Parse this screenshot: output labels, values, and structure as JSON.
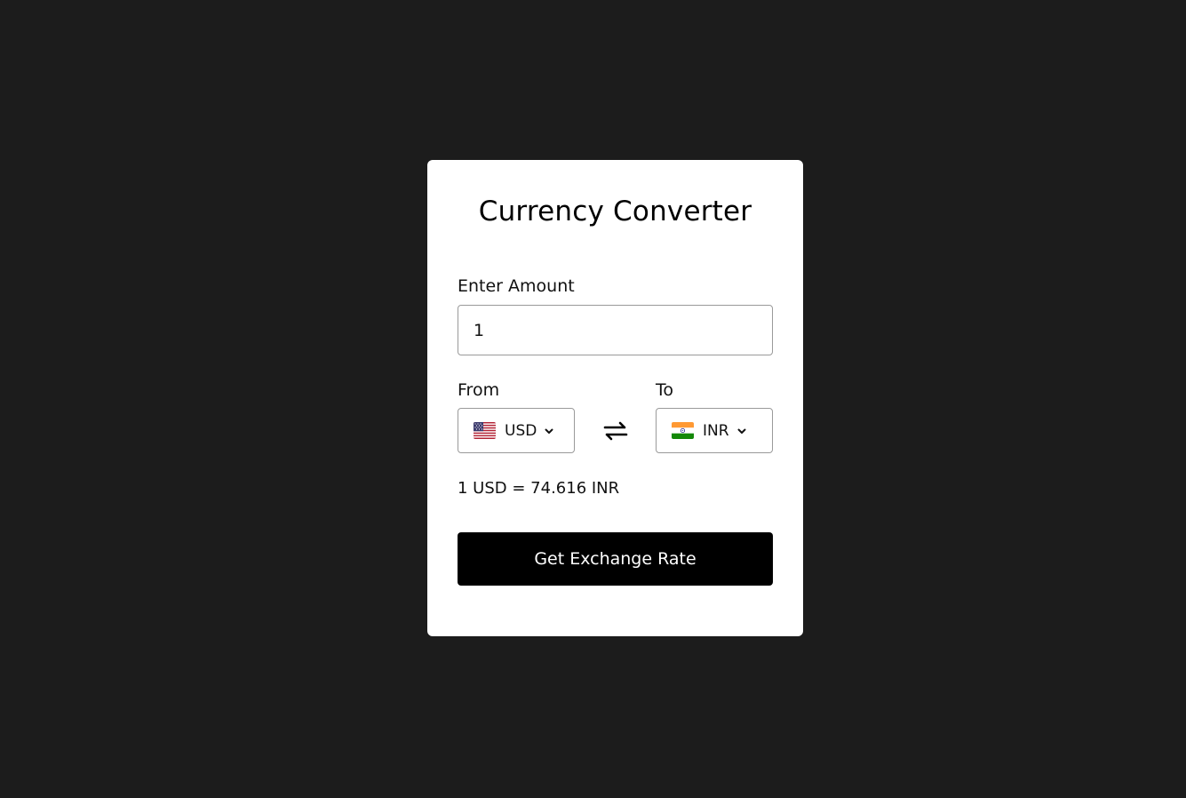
{
  "app": {
    "title": "Currency Converter"
  },
  "amount": {
    "label": "Enter Amount",
    "value": "1"
  },
  "from": {
    "label": "From",
    "currency": "USD",
    "flag_icon": "us-flag-icon"
  },
  "to": {
    "label": "To",
    "currency": "INR",
    "flag_icon": "india-flag-icon"
  },
  "swap_icon": "swap-arrows-icon",
  "result": {
    "text": "1 USD = 74.616 INR"
  },
  "button": {
    "label": "Get Exchange Rate"
  },
  "colors": {
    "background": "#1c1c1c",
    "card": "#ffffff",
    "button": "#000000"
  }
}
